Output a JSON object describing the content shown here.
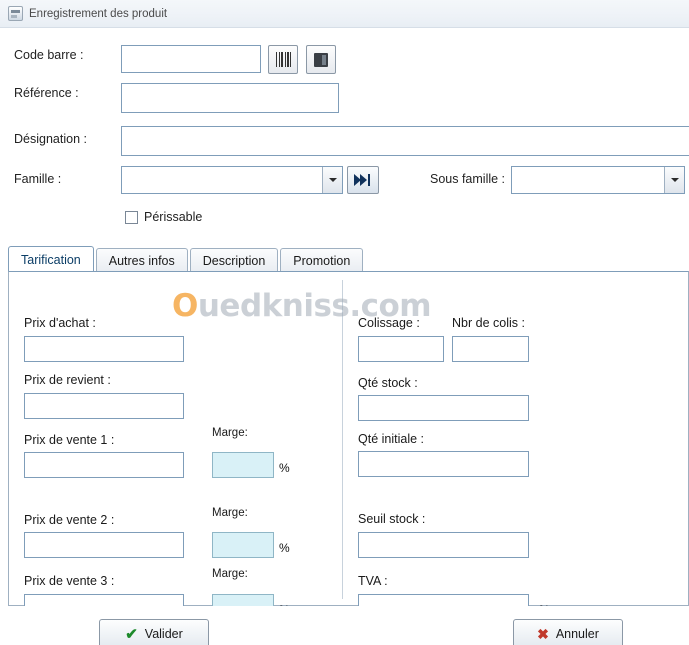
{
  "window": {
    "title": "Enregistrement des produit",
    "icon": "product-register-icon"
  },
  "form": {
    "code_barre_label": "Code barre :",
    "code_barre_value": "",
    "barcode_button_icon": "barcode-icon",
    "package_button_icon": "box-icon",
    "reference_label": "Référence :",
    "reference_value": "",
    "designation_label": "Désignation :",
    "designation_value": "",
    "famille_label": "Famille :",
    "famille_value": "",
    "next_button_icon": "skip-forward-icon",
    "sous_famille_label": "Sous famille :",
    "sous_famille_value": "",
    "perissable_label": "Périssable",
    "perissable_checked": false
  },
  "tabs": [
    {
      "label": "Tarification",
      "active": true
    },
    {
      "label": "Autres infos",
      "active": false
    },
    {
      "label": "Description",
      "active": false
    },
    {
      "label": "Promotion",
      "active": false
    }
  ],
  "tarification": {
    "left": [
      {
        "label": "Prix d'achat :",
        "value": ""
      },
      {
        "label": "Prix de revient :",
        "value": ""
      },
      {
        "label": "Prix de vente 1 :",
        "value": "",
        "marge_label": "Marge:",
        "marge_value": "",
        "pct": "%"
      },
      {
        "label": "Prix de vente 2 :",
        "value": "",
        "marge_label": "Marge:",
        "marge_value": "",
        "pct": "%"
      },
      {
        "label": "Prix de vente 3 :",
        "value": "",
        "marge_label": "Marge:",
        "marge_value": "",
        "pct": "%"
      }
    ],
    "right": [
      {
        "label": "Colissage :",
        "value": ""
      },
      {
        "label": "Nbr de colis :",
        "value": ""
      },
      {
        "label": "Qté stock :",
        "value": ""
      },
      {
        "label": "Qté initiale :",
        "value": ""
      },
      {
        "label": "Seuil stock :",
        "value": ""
      },
      {
        "label": "TVA :",
        "value": "",
        "pct": "%"
      }
    ]
  },
  "footer": {
    "validate_label": "Valider",
    "cancel_label": "Annuler"
  },
  "watermark": {
    "first": "O",
    "rest": "uedkniss.com",
    "accent_color": "#f4a23c",
    "text_color": "#a0aab4"
  }
}
